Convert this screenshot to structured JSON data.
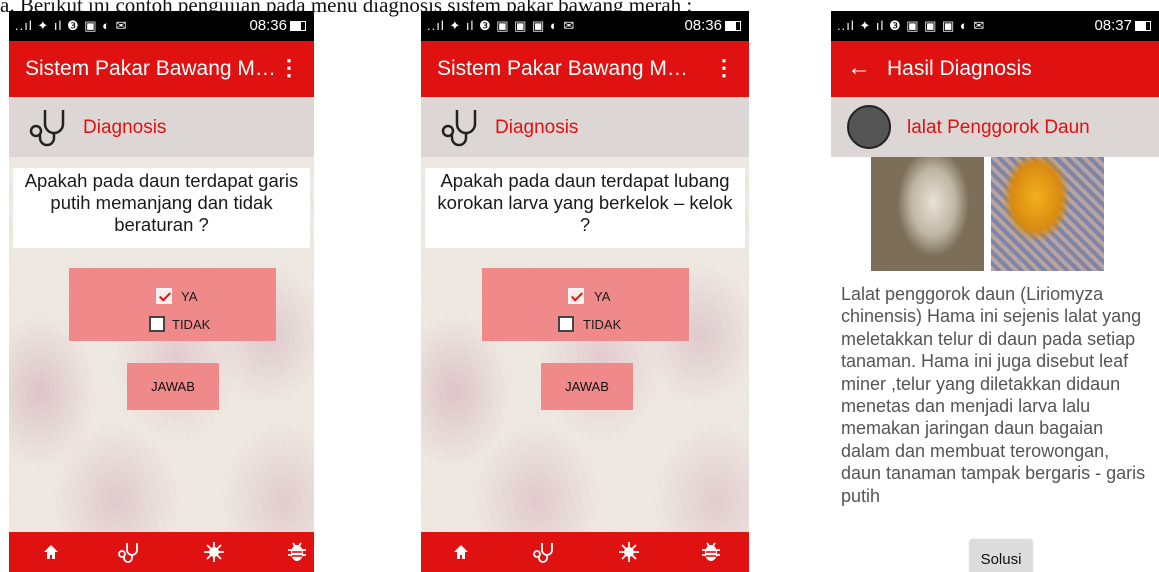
{
  "caption": "a. Berikut ini contoh pengujian pada menu diagnosis sistem pakar bawang merah :",
  "screens": [
    {
      "status": {
        "signal": "..ıl ✦ ıl ❸ ▣ ◐ ✉",
        "time": "08:36"
      },
      "app_title": "Sistem Pakar Bawang M…",
      "section_label": "Diagnosis",
      "question": "Apakah pada daun terdapat garis putih memanjang dan tidak beraturan ?",
      "options": [
        {
          "label": "YA",
          "checked": true
        },
        {
          "label": "TIDAK",
          "checked": false
        }
      ],
      "submit_label": "JAWAB"
    },
    {
      "status": {
        "signal": "..ıl ✦ ıl ❸ ▣ ▣ ▣ ◐ ✉",
        "time": "08:36"
      },
      "app_title": "Sistem Pakar Bawang M…",
      "section_label": "Diagnosis",
      "question": "Apakah pada daun terdapat lubang  korokan larva yang berkelok – kelok ?",
      "options": [
        {
          "label": "YA",
          "checked": true
        },
        {
          "label": "TIDAK",
          "checked": false
        }
      ],
      "submit_label": "JAWAB"
    },
    {
      "status": {
        "signal": "..ıl ✦ ıl ❸ ▣ ▣ ▣ ◐ ✉",
        "time": "08:37"
      },
      "app_title": "Hasil Diagnosis",
      "result_title": "lalat Penggorok Daun",
      "description": "Lalat penggorok daun (Liriomyza chinensis) Hama ini sejenis lalat yang meletakkan telur di daun pada setiap tanaman. Hama ini juga disebut leaf miner ,telur yang diletakkan didaun menetas dan menjadi larva lalu memakan jaringan daun bagaian dalam dan membuat terowongan, daun tanaman tampak bergaris - garis putih",
      "solution_label": "Solusi"
    }
  ],
  "icons": {
    "overflow_menu": "⋮",
    "back_arrow": "←",
    "nav": [
      "home-icon",
      "stethoscope-icon",
      "virus-icon",
      "bug-icon"
    ]
  },
  "colors": {
    "primary": "#e01111",
    "answer_box": "#f08a8a",
    "header_band": "#dcd6d4"
  }
}
